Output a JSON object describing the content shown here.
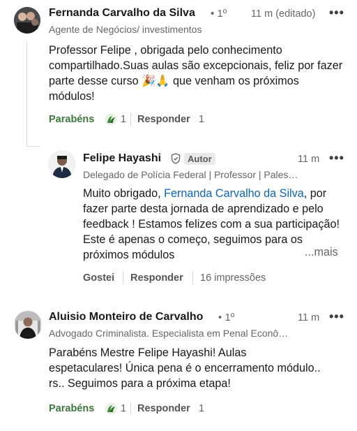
{
  "comments": [
    {
      "author": "Fernanda Carvalho da Silva",
      "degree": "• 1º",
      "headline": "Agente de Negócios/ investimentos",
      "time": "11 m (editado)",
      "more": "•••",
      "text": "Professor Felipe , obrigada pelo conhecimento compartilhado.Suas aulas são excepcionais, feliz por fazer parte desse curso 🎉🙏 que venham os próximos módulos!",
      "actions": {
        "react_label": "Parabéns",
        "react_count": "1",
        "reply_label": "Responder",
        "reply_count": "1"
      }
    },
    {
      "author": "Felipe Hayashi",
      "badge": "Autor",
      "headline": "Delegado de Polícia Federal | Professor | Pales…",
      "time": "11 m",
      "more": "•••",
      "text_prefix": "Muito obrigado, ",
      "mention": "Fernanda Carvalho da Silva",
      "text_suffix": ", por fazer parte desta jornada de aprendizado e pelo feedback ! Estamos felizes com a sua participação! Este é apenas o começo, seguimos para os próximos módulos",
      "see_more": "...mais",
      "actions": {
        "like_label": "Gostei",
        "reply_label": "Responder",
        "impressions": "16 impressões"
      }
    },
    {
      "author": "Aluisio Monteiro de Carvalho",
      "degree": "• 1º",
      "headline": "Advogado Criminalista. Especialista em Penal Econô…",
      "time": "11 m",
      "more": "•••",
      "text": "Parabéns Mestre Felipe Hayashi! Aulas espetaculares! Única pena é o encerramento módulo.. rs..  Seguimos para a próxima etapa!",
      "actions": {
        "react_label": "Parabéns",
        "react_count": "1",
        "reply_label": "Responder",
        "reply_count": "1"
      }
    }
  ],
  "icons": {
    "celebrate": "celebrate-reaction-icon",
    "verified": "verified-shield-icon"
  }
}
